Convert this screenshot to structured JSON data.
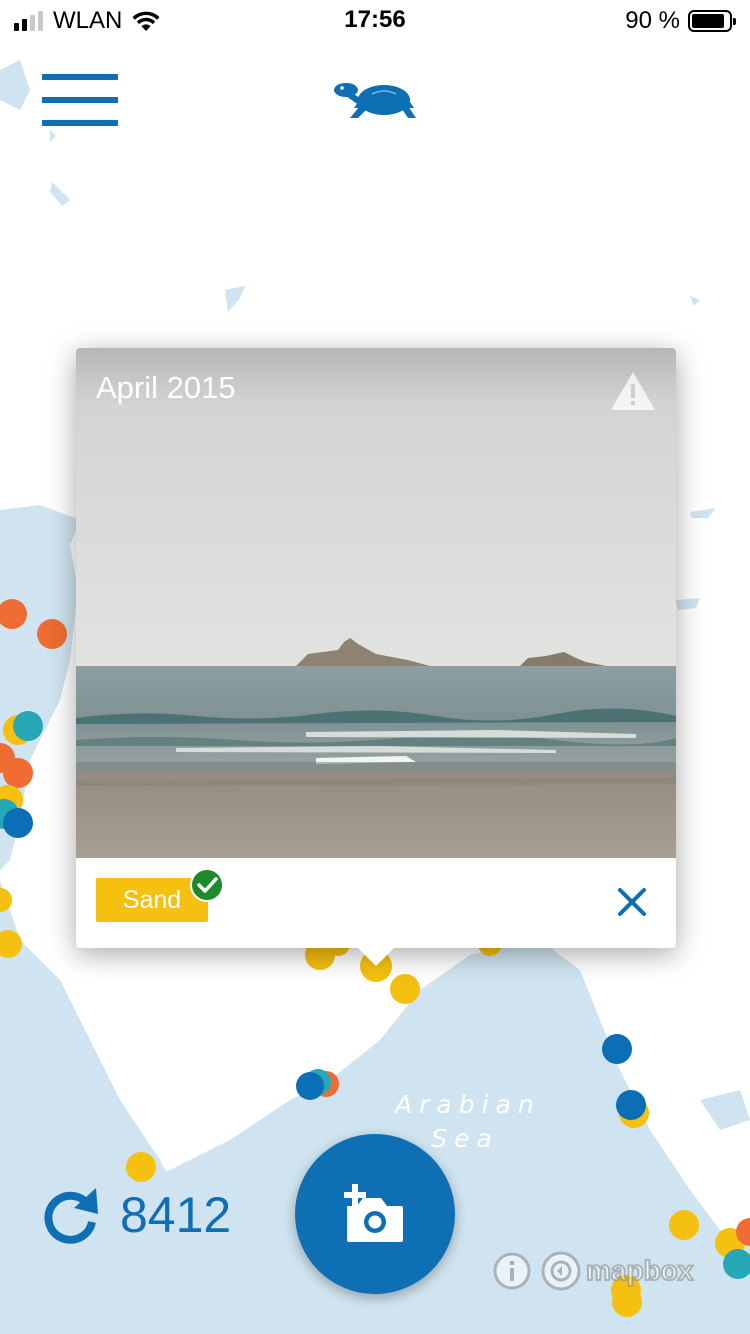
{
  "status_bar": {
    "carrier": "WLAN",
    "time": "17:56",
    "battery_percent": "90 %",
    "battery_level": 0.9,
    "signal_bars": 4,
    "signal_bars_filled": 2
  },
  "header": {
    "menu_icon": "hamburger-menu-icon",
    "logo_icon": "turtle-logo-icon",
    "brand_color": "#0e6fb5"
  },
  "map": {
    "water_color": "#cfe4f0",
    "land_color": "#ffffff",
    "label": [
      "Arabian",
      "Sea"
    ],
    "attribution": "mapbox",
    "marker_colors": {
      "orange": "#ef6c34",
      "yellow": "#f5c010",
      "teal": "#26a8b6",
      "blue": "#0c6eb4"
    }
  },
  "popup": {
    "date": "April 2015",
    "report_icon": "warning-icon",
    "tag": "Sand",
    "tag_color": "#f5c010",
    "verified_icon": "check-circle-icon",
    "close_icon": "close-icon"
  },
  "bottom": {
    "refresh_icon": "refresh-icon",
    "count": "8412",
    "add_photo_icon": "add-photo-icon"
  }
}
